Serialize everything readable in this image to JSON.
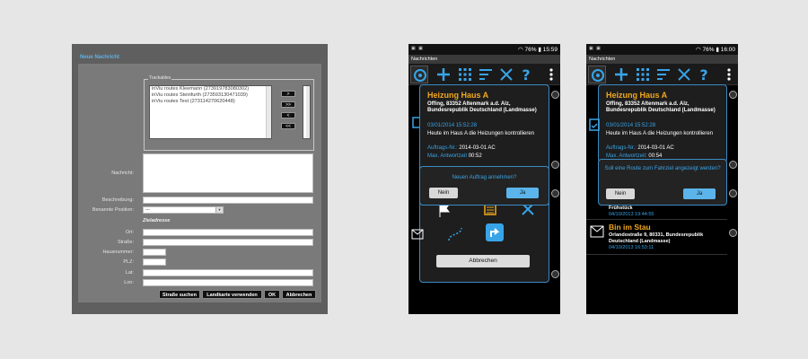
{
  "webform": {
    "title": "Neue Nachricht",
    "trackables_legend": "Trackables",
    "trackables": [
      "inViu routes Kleemann (273919783080302)",
      "inViu routes Steinfurth (273593130471039)",
      "inViu routes Test (273114270620448)"
    ],
    "move_buttons": [
      ">",
      ">>",
      "<",
      "<<"
    ],
    "labels": {
      "nachricht": "Nachricht:",
      "beschreibung": "Beschreibung:",
      "benannte_position": "Benannte Position:",
      "ort": "Ort:",
      "strasse": "Straße:",
      "hausnummer": "Hausnummer:",
      "plz": "PLZ:",
      "lat": "Lat:",
      "lon": "Lon:"
    },
    "position_select_value": "---",
    "section_zieladresse": "Zieladresse",
    "buttons": {
      "strasse_suchen": "Straße suchen",
      "landkarte": "Landkarte verwenden",
      "ok": "OK",
      "abbrechen": "Abbrechen"
    }
  },
  "phone1": {
    "status_time": "15:59",
    "battery": "76%",
    "app_title": "Nachrichten",
    "card": {
      "title": "Heizung Haus A",
      "address": "Offing, 83352 Altenmark a.d. Alz, Bundesrepublik Deutschland (Landmasse)",
      "date": "03/01/2014 15:52:28",
      "text": "Heute im Haus A die Heizungen kontrollieren",
      "auftrag_label": "Auftrags-Nr.:",
      "auftrag_value": "2014-03-01 AC",
      "antwort_label": "Max. Antwortzeit",
      "antwort_value": "00:52"
    },
    "dialog": {
      "question": "Neuen Auftrag annehmen?",
      "no": "Nein",
      "yes": "Ja"
    },
    "cancel": "Abbrechen"
  },
  "phone2": {
    "status_time": "16:00",
    "battery": "76%",
    "app_title": "Nachrichten",
    "card": {
      "title": "Heizung Haus A",
      "address": "Offing, 83352 Altenmark a.d. Alz, Bundesrepublik Deutschland (Landmasse)",
      "date": "03/01/2014 15:52:28",
      "text": "Heute im Haus A die Heizungen kontrollieren",
      "auftrag_label": "Auftrags-Nr.:",
      "auftrag_value": "2014-03-01 AC",
      "antwort_label": "Max. Antwortzeit:",
      "antwort_value": "00:54"
    },
    "dialog": {
      "question": "Soll eine Route zum Fahrziel angezeigt werden?",
      "no": "Nein",
      "yes": "Ja"
    },
    "list": [
      {
        "title": "",
        "address": "Frühstück",
        "date": "04/10/2013 19:44:55"
      },
      {
        "title": "Bin im Stau",
        "address": "Orlandostraße 9, 80331, Bundesrepublik Deutschland (Landmasse)",
        "date": "04/10/2013 16:53:11"
      }
    ]
  },
  "colors": {
    "accent_blue": "#38a4e8",
    "title_orange": "#f2a81c",
    "form_bg": "#5f5f5f"
  }
}
